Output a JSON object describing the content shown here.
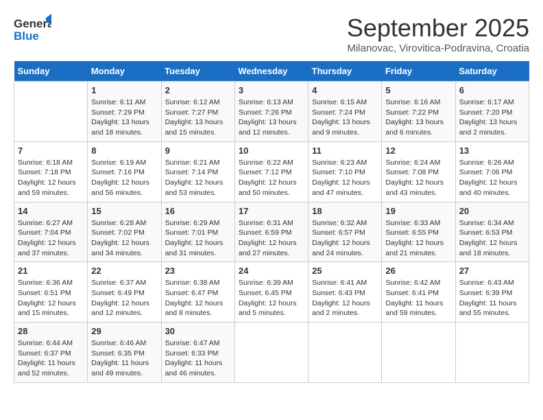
{
  "header": {
    "logo_general": "General",
    "logo_blue": "Blue",
    "month_title": "September 2025",
    "subtitle": "Milanovac, Virovitica-Podravina, Croatia"
  },
  "days_of_week": [
    "Sunday",
    "Monday",
    "Tuesday",
    "Wednesday",
    "Thursday",
    "Friday",
    "Saturday"
  ],
  "weeks": [
    [
      {
        "day": "",
        "info": ""
      },
      {
        "day": "1",
        "info": "Sunrise: 6:11 AM\nSunset: 7:29 PM\nDaylight: 13 hours and 18 minutes."
      },
      {
        "day": "2",
        "info": "Sunrise: 6:12 AM\nSunset: 7:27 PM\nDaylight: 13 hours and 15 minutes."
      },
      {
        "day": "3",
        "info": "Sunrise: 6:13 AM\nSunset: 7:26 PM\nDaylight: 13 hours and 12 minutes."
      },
      {
        "day": "4",
        "info": "Sunrise: 6:15 AM\nSunset: 7:24 PM\nDaylight: 13 hours and 9 minutes."
      },
      {
        "day": "5",
        "info": "Sunrise: 6:16 AM\nSunset: 7:22 PM\nDaylight: 13 hours and 6 minutes."
      },
      {
        "day": "6",
        "info": "Sunrise: 6:17 AM\nSunset: 7:20 PM\nDaylight: 13 hours and 2 minutes."
      }
    ],
    [
      {
        "day": "7",
        "info": "Sunrise: 6:18 AM\nSunset: 7:18 PM\nDaylight: 12 hours and 59 minutes."
      },
      {
        "day": "8",
        "info": "Sunrise: 6:19 AM\nSunset: 7:16 PM\nDaylight: 12 hours and 56 minutes."
      },
      {
        "day": "9",
        "info": "Sunrise: 6:21 AM\nSunset: 7:14 PM\nDaylight: 12 hours and 53 minutes."
      },
      {
        "day": "10",
        "info": "Sunrise: 6:22 AM\nSunset: 7:12 PM\nDaylight: 12 hours and 50 minutes."
      },
      {
        "day": "11",
        "info": "Sunrise: 6:23 AM\nSunset: 7:10 PM\nDaylight: 12 hours and 47 minutes."
      },
      {
        "day": "12",
        "info": "Sunrise: 6:24 AM\nSunset: 7:08 PM\nDaylight: 12 hours and 43 minutes."
      },
      {
        "day": "13",
        "info": "Sunrise: 6:26 AM\nSunset: 7:06 PM\nDaylight: 12 hours and 40 minutes."
      }
    ],
    [
      {
        "day": "14",
        "info": "Sunrise: 6:27 AM\nSunset: 7:04 PM\nDaylight: 12 hours and 37 minutes."
      },
      {
        "day": "15",
        "info": "Sunrise: 6:28 AM\nSunset: 7:02 PM\nDaylight: 12 hours and 34 minutes."
      },
      {
        "day": "16",
        "info": "Sunrise: 6:29 AM\nSunset: 7:01 PM\nDaylight: 12 hours and 31 minutes."
      },
      {
        "day": "17",
        "info": "Sunrise: 6:31 AM\nSunset: 6:59 PM\nDaylight: 12 hours and 27 minutes."
      },
      {
        "day": "18",
        "info": "Sunrise: 6:32 AM\nSunset: 6:57 PM\nDaylight: 12 hours and 24 minutes."
      },
      {
        "day": "19",
        "info": "Sunrise: 6:33 AM\nSunset: 6:55 PM\nDaylight: 12 hours and 21 minutes."
      },
      {
        "day": "20",
        "info": "Sunrise: 6:34 AM\nSunset: 6:53 PM\nDaylight: 12 hours and 18 minutes."
      }
    ],
    [
      {
        "day": "21",
        "info": "Sunrise: 6:36 AM\nSunset: 6:51 PM\nDaylight: 12 hours and 15 minutes."
      },
      {
        "day": "22",
        "info": "Sunrise: 6:37 AM\nSunset: 6:49 PM\nDaylight: 12 hours and 12 minutes."
      },
      {
        "day": "23",
        "info": "Sunrise: 6:38 AM\nSunset: 6:47 PM\nDaylight: 12 hours and 8 minutes."
      },
      {
        "day": "24",
        "info": "Sunrise: 6:39 AM\nSunset: 6:45 PM\nDaylight: 12 hours and 5 minutes."
      },
      {
        "day": "25",
        "info": "Sunrise: 6:41 AM\nSunset: 6:43 PM\nDaylight: 12 hours and 2 minutes."
      },
      {
        "day": "26",
        "info": "Sunrise: 6:42 AM\nSunset: 6:41 PM\nDaylight: 11 hours and 59 minutes."
      },
      {
        "day": "27",
        "info": "Sunrise: 6:43 AM\nSunset: 6:39 PM\nDaylight: 11 hours and 55 minutes."
      }
    ],
    [
      {
        "day": "28",
        "info": "Sunrise: 6:44 AM\nSunset: 6:37 PM\nDaylight: 11 hours and 52 minutes."
      },
      {
        "day": "29",
        "info": "Sunrise: 6:46 AM\nSunset: 6:35 PM\nDaylight: 11 hours and 49 minutes."
      },
      {
        "day": "30",
        "info": "Sunrise: 6:47 AM\nSunset: 6:33 PM\nDaylight: 11 hours and 46 minutes."
      },
      {
        "day": "",
        "info": ""
      },
      {
        "day": "",
        "info": ""
      },
      {
        "day": "",
        "info": ""
      },
      {
        "day": "",
        "info": ""
      }
    ]
  ]
}
